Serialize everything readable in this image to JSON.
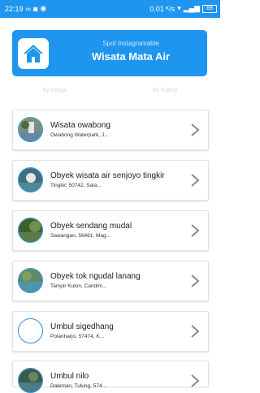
{
  "status_bar": {
    "time": "22:19",
    "speed": "0.01 ᴷ/s",
    "battery": "69"
  },
  "header": {
    "subtitle": "Spot Instagramable",
    "title": "Wisata Mata Air",
    "icon": "home-icon"
  },
  "tabs": [
    {
      "label": "By Harga"
    },
    {
      "label": "By Rating"
    }
  ],
  "items": [
    {
      "name": "Wisata owabong",
      "address": "Owabong Waterpark, J...",
      "has_photo": true
    },
    {
      "name": "Obyek wisata air senjoyo tingkir",
      "address": "Tingkir, 50742, Sala...",
      "has_photo": true
    },
    {
      "name": "Obyek sendang mudal",
      "address": "Sawangan, 56481, Mag...",
      "has_photo": true
    },
    {
      "name": "Obyek tok ngudal lanang",
      "address": "Tampir Kulon, Candim...",
      "has_photo": true
    },
    {
      "name": "Umbul sigedhang",
      "address": "Polanharjo, 57474, K...",
      "has_photo": false
    },
    {
      "name": "Umbul nilo",
      "address": "Daleman, Tulung, 574...",
      "has_photo": true
    }
  ],
  "colors": {
    "accent": "#1e96f0",
    "avatar_border": "#2e8fe0"
  }
}
